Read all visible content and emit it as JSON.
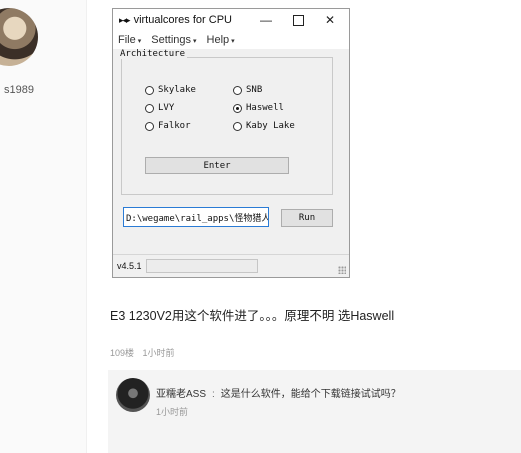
{
  "left_panel": {
    "username": "s1989"
  },
  "window": {
    "title": "virtualcores for CPU",
    "app_icon": "▸◂▸",
    "controls": {
      "minimize": "—",
      "close": "✕"
    },
    "menu": [
      {
        "label": "File"
      },
      {
        "label": "Settings"
      },
      {
        "label": "Help"
      }
    ],
    "menu_caret": "▾",
    "group_label": "Architecture",
    "options": [
      {
        "label": "Skylake",
        "selected": false
      },
      {
        "label": "SNB",
        "selected": false
      },
      {
        "label": "LVY",
        "selected": false
      },
      {
        "label": "Haswell",
        "selected": true
      },
      {
        "label": "Falkor",
        "selected": false
      },
      {
        "label": "Kaby Lake",
        "selected": false
      }
    ],
    "enter_button": "Enter",
    "path_value": "D:\\wegame\\rail_apps\\怪物猎人",
    "run_button": "Run",
    "version": "v4.5.1"
  },
  "post": {
    "text": "E3 1230V2用这个软件进了。。。原理不明 选Haswell",
    "floor": "109楼",
    "time": "1小时前"
  },
  "reply": {
    "user": "亚糯老ASS",
    "sep": ":",
    "text": "这是什么软件，能给个下载链接试试吗？",
    "time": "1小时前"
  }
}
